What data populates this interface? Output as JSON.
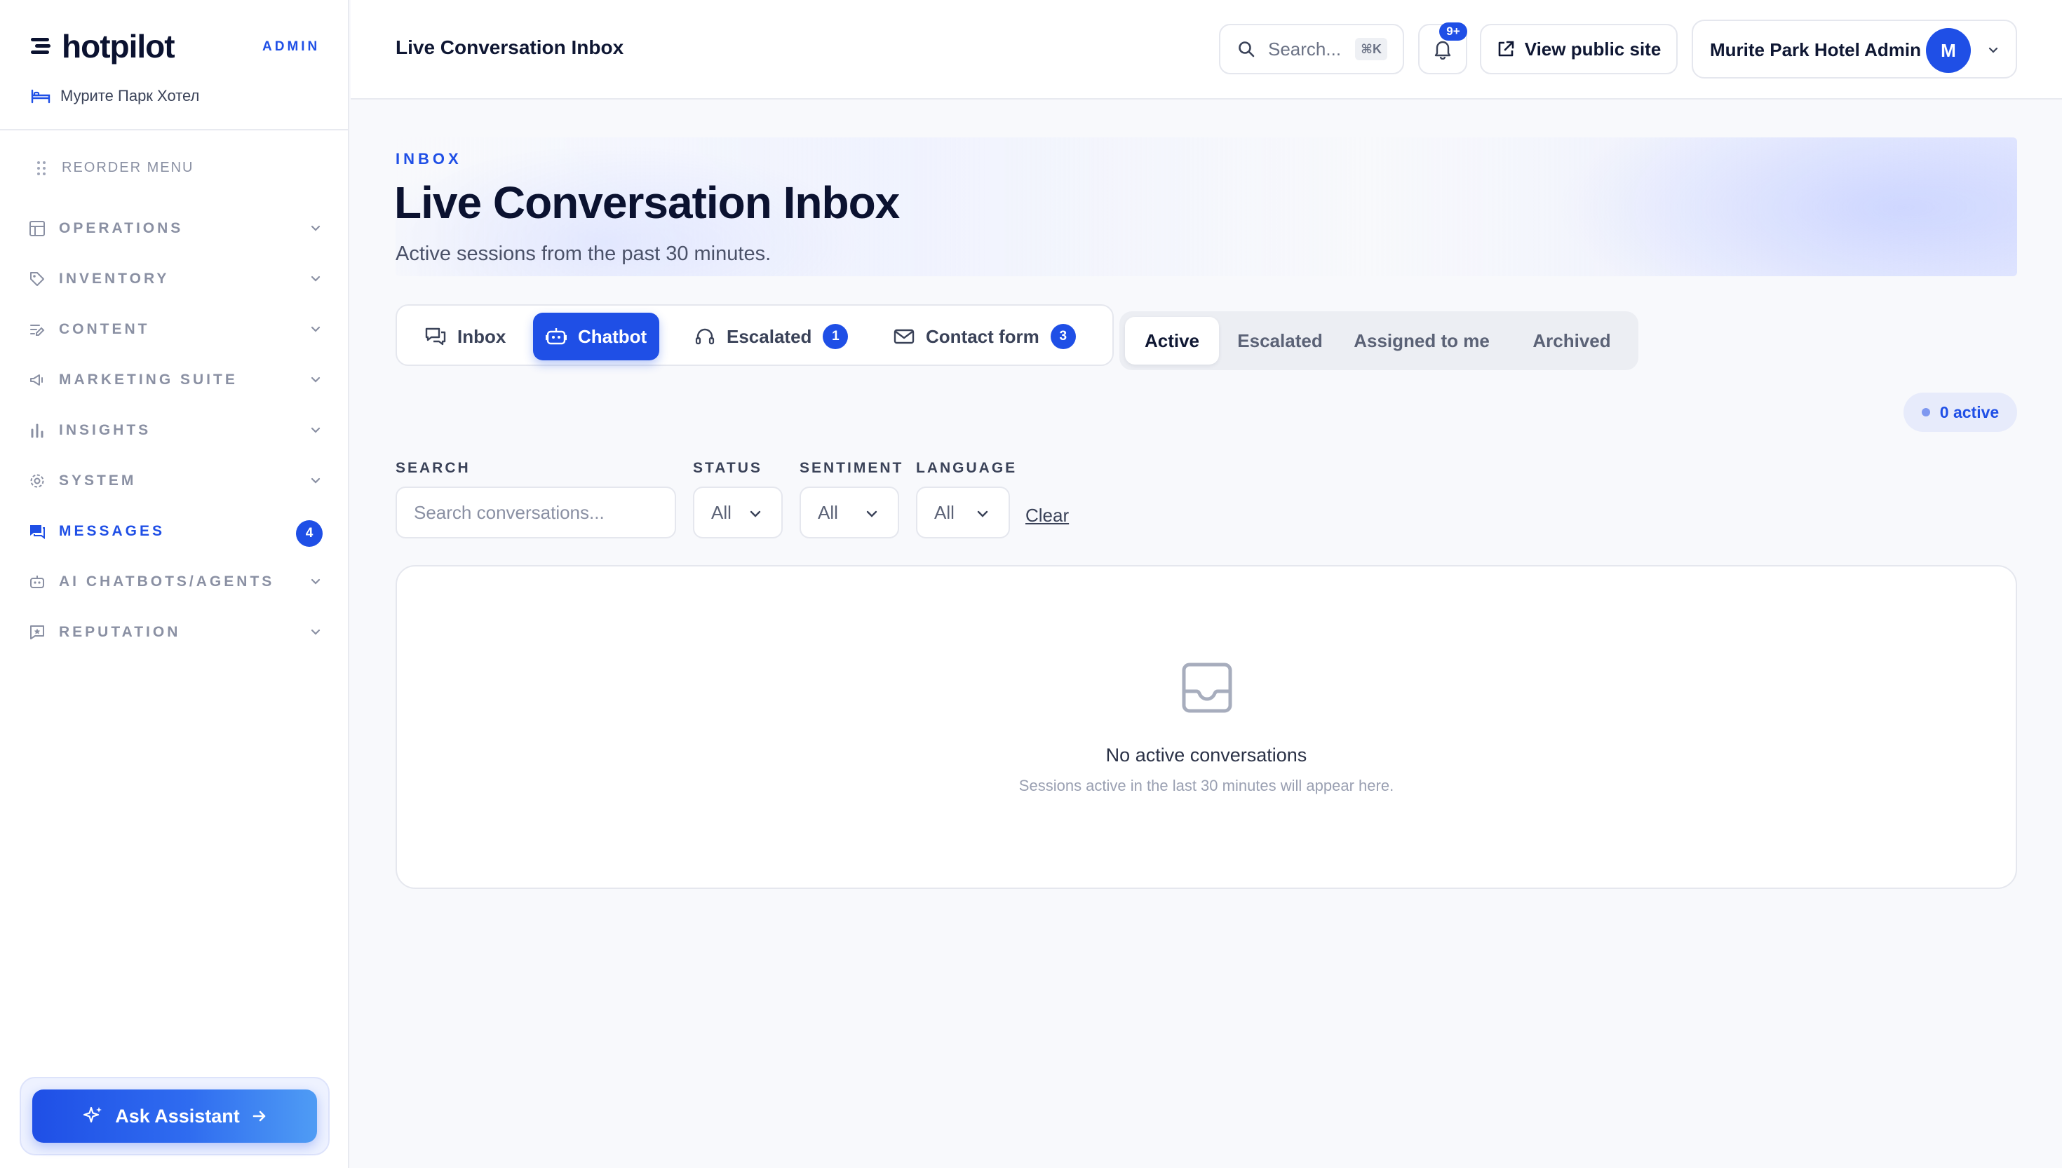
{
  "brand": {
    "name": "hotpilot",
    "role": "ADMIN",
    "hotel": "Мурите Парк Хотел"
  },
  "sidebar": {
    "reorder_label": "REORDER MENU",
    "items": [
      {
        "label": "OPERATIONS",
        "icon": "layout-icon"
      },
      {
        "label": "INVENTORY",
        "icon": "tag-icon"
      },
      {
        "label": "CONTENT",
        "icon": "edit-icon"
      },
      {
        "label": "MARKETING SUITE",
        "icon": "megaphone-icon"
      },
      {
        "label": "INSIGHTS",
        "icon": "bar-chart-icon"
      },
      {
        "label": "SYSTEM",
        "icon": "gear-icon"
      },
      {
        "label": "MESSAGES",
        "icon": "chat-icon",
        "badge": "4",
        "active": true
      },
      {
        "label": "AI CHATBOTS/AGENTS",
        "icon": "bot-icon"
      },
      {
        "label": "REPUTATION",
        "icon": "review-icon"
      }
    ],
    "assistant_label": "Ask Assistant"
  },
  "topbar": {
    "title": "Live Conversation Inbox",
    "search_placeholder": "Search...",
    "search_shortcut": "⌘K",
    "notification_badge": "9+",
    "public_site_label": "View public site",
    "user_name": "Murite Park Hotel Admin",
    "avatar_initial": "M"
  },
  "hero": {
    "eyebrow": "INBOX",
    "title": "Live Conversation Inbox",
    "subtitle": "Active sessions from the past 30 minutes."
  },
  "channel_tabs": [
    {
      "label": "Inbox"
    },
    {
      "label": "Chatbot",
      "active": true
    },
    {
      "label": "Escalated",
      "count": "1"
    },
    {
      "label": "Contact form",
      "count": "3"
    }
  ],
  "status_tabs": [
    {
      "label": "Active",
      "active": true
    },
    {
      "label": "Escalated"
    },
    {
      "label": "Assigned to me"
    },
    {
      "label": "Archived"
    }
  ],
  "active_count_label": "0 active",
  "filters": {
    "search_label": "SEARCH",
    "search_placeholder": "Search conversations...",
    "status_label": "STATUS",
    "status_value": "All",
    "sentiment_label": "SENTIMENT",
    "sentiment_value": "All",
    "language_label": "LANGUAGE",
    "language_value": "All",
    "clear_label": "Clear"
  },
  "empty_state": {
    "title": "No active conversations",
    "subtitle": "Sessions active in the last 30 minutes will appear here."
  },
  "colors": {
    "accent": "#1f4fe6",
    "muted": "#8a90a3",
    "border": "#e5e7ee"
  }
}
